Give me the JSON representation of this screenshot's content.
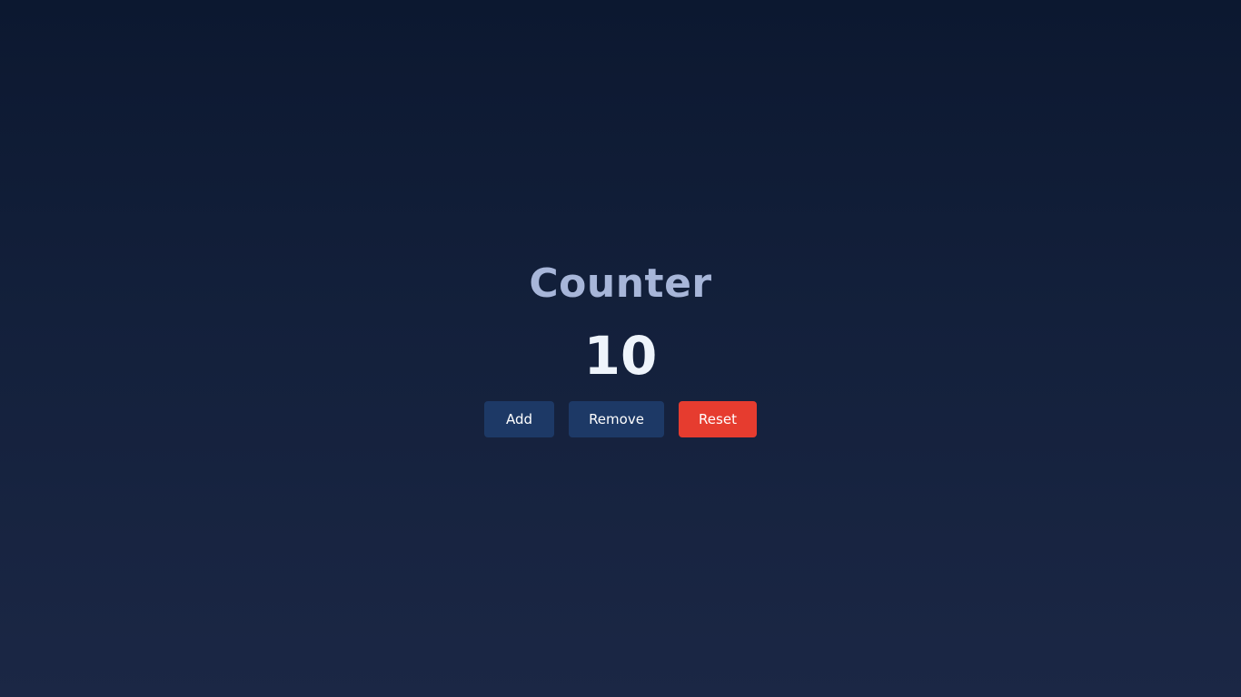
{
  "app": {
    "title": "Counter",
    "count": "10"
  },
  "buttons": {
    "add_label": "Add",
    "remove_label": "Remove",
    "reset_label": "Reset"
  },
  "colors": {
    "background_top": "#0c1830",
    "background_bottom": "#1b2745",
    "title": "#a7b6d9",
    "count": "#eef4fb",
    "primary_button": "#1d3966",
    "danger_button": "#e63c2f"
  }
}
